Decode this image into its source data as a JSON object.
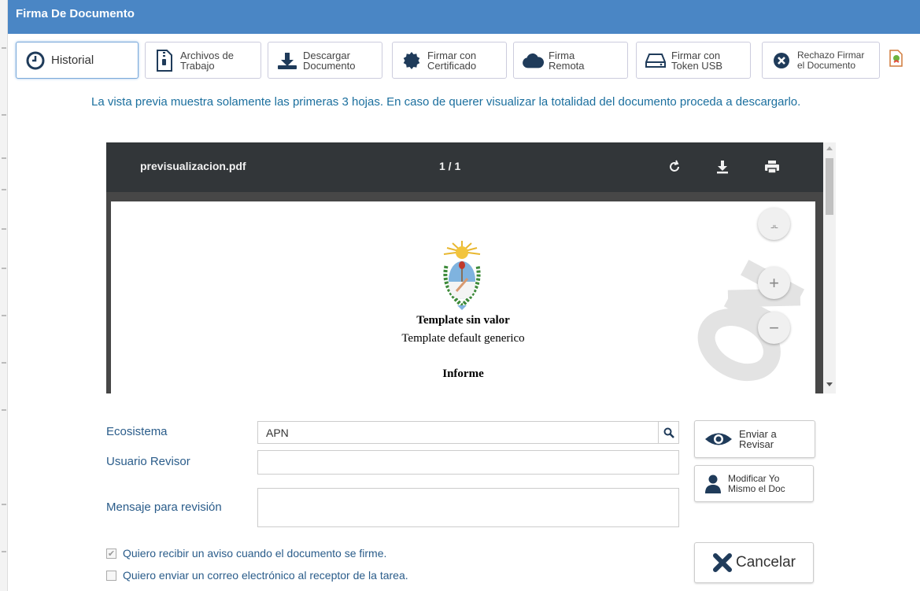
{
  "window": {
    "title": "Firma De Documento"
  },
  "toolbar": {
    "buttons": [
      {
        "label": "Historial",
        "icon": "clock-icon"
      },
      {
        "label": "Archivos de Trabajo",
        "icon": "file-zip-icon"
      },
      {
        "label": "Descargar Documento",
        "icon": "download-icon"
      },
      {
        "label": "Firmar con Certificado",
        "icon": "certificate-icon"
      },
      {
        "label": "Firma Remota",
        "icon": "cloud-icon"
      },
      {
        "label": "Firmar con Token USB",
        "icon": "usb-drive-icon"
      },
      {
        "label": "Rechazo Firmar el Documento",
        "icon": "times-circle-icon"
      }
    ]
  },
  "notice": "La vista previa muestra solamente las primeras 3 hojas. En caso de querer visualizar la totalidad del documento proceda a descargarlo.",
  "viewer": {
    "filename": "previsualizacion.pdf",
    "page_indicator": "1 / 1",
    "doc_title": "Template sin valor",
    "doc_subtitle": "Template default generico",
    "doc_heading": "Informe"
  },
  "form": {
    "ecosistema_label": "Ecosistema",
    "ecosistema_value": "APN",
    "usuario_label": "Usuario Revisor",
    "usuario_value": "",
    "mensaje_label": "Mensaje para revisión",
    "mensaje_value": "",
    "check1_label": "Quiero recibir un aviso cuando el documento se firme.",
    "check1_checked": true,
    "check2_label": "Quiero enviar un correo electrónico al receptor de la tarea.",
    "check2_checked": false
  },
  "actions": {
    "enviar": "Enviar a Revisar",
    "modificar": "Modificar Yo Mismo el Doc",
    "cancelar": "Cancelar"
  },
  "colors": {
    "titlebar": "#4a86c5",
    "notice": "#1b6f9e",
    "label": "#2a5c8a",
    "viewer_bar": "#323639"
  }
}
